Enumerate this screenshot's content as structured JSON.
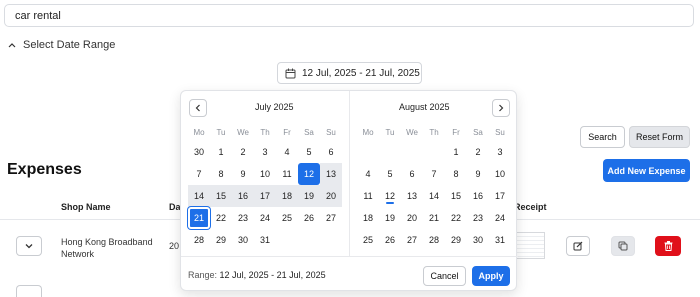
{
  "search": {
    "value": "car rental"
  },
  "date_range": {
    "toggle_label": "Select Date Range",
    "trigger_text": "12 Jul, 2025 - 21 Jul, 2025"
  },
  "actions": {
    "search_label": "Search",
    "reset_label": "Reset Form",
    "add_label": "Add New Expense"
  },
  "expenses": {
    "title": "Expenses",
    "headers": {
      "shop": "Shop Name",
      "date": "Da",
      "receipt": "Receipt"
    },
    "rows": [
      {
        "shop": "Hong Kong Broadband Network",
        "date": "20"
      }
    ]
  },
  "calendar": {
    "weekdays": [
      "Mo",
      "Tu",
      "We",
      "Th",
      "Fr",
      "Sa",
      "Su"
    ],
    "months": [
      {
        "title": "July 2025",
        "weeks": [
          [
            "30",
            "1",
            "2",
            "3",
            "4",
            "5",
            "6"
          ],
          [
            "7",
            "8",
            "9",
            "10",
            "11",
            "12",
            "13"
          ],
          [
            "14",
            "15",
            "16",
            "17",
            "18",
            "19",
            "20"
          ],
          [
            "21",
            "22",
            "23",
            "24",
            "25",
            "26",
            "27"
          ],
          [
            "28",
            "29",
            "30",
            "31",
            "",
            "",
            ""
          ]
        ],
        "first_visible": "1"
      },
      {
        "title": "August 2025",
        "weeks": [
          [
            "",
            "",
            "",
            "",
            "1",
            "2",
            "3"
          ],
          [
            "4",
            "5",
            "6",
            "7",
            "8",
            "9",
            "10"
          ],
          [
            "11",
            "12",
            "13",
            "14",
            "15",
            "16",
            "17"
          ],
          [
            "18",
            "19",
            "20",
            "21",
            "22",
            "23",
            "24"
          ],
          [
            "25",
            "26",
            "27",
            "28",
            "29",
            "30",
            "31"
          ]
        ]
      }
    ],
    "range_start_day": "12",
    "range_end_day": "21",
    "today_day": "12",
    "range_label": "Range:",
    "range_value": "12 Jul, 2025 - 21 Jul, 2025",
    "cancel_label": "Cancel",
    "apply_label": "Apply"
  },
  "colors": {
    "accent": "#1d6fe8",
    "danger": "#e0101a",
    "range_bg": "#e8eaee"
  }
}
